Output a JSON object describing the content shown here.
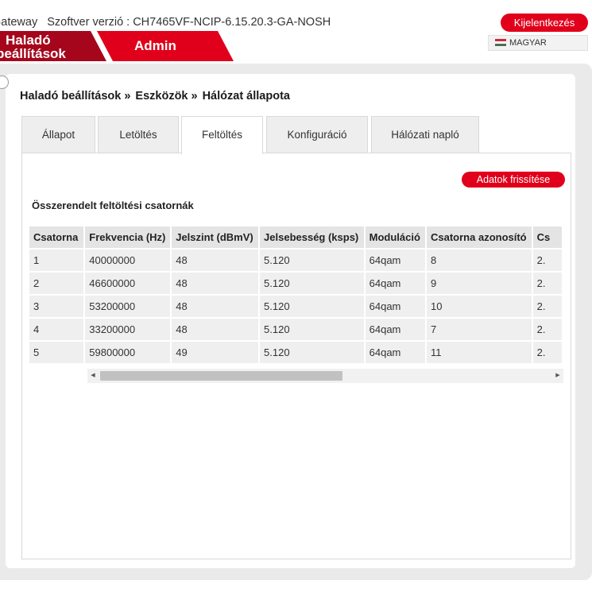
{
  "header": {
    "gateway_label": "Gateway",
    "version_label": "Szoftver verzió : CH7465VF-NCIP-6.15.20.3-GA-NOSH",
    "logout_label": "Kijelentkezés",
    "language_label": "MAGYAR",
    "tab_advanced_line1": "Haladó",
    "tab_advanced_line2": "beállítások",
    "tab_admin_label": "Admin"
  },
  "breadcrumb": {
    "item1": "Haladó beállítások",
    "item2": "Eszközök",
    "item3": "Hálózat állapota",
    "separator": "»"
  },
  "tabs": [
    {
      "label": "Állapot"
    },
    {
      "label": "Letöltés"
    },
    {
      "label": "Feltöltés"
    },
    {
      "label": "Konfiguráció"
    },
    {
      "label": "Hálózati napló"
    }
  ],
  "main": {
    "refresh_label": "Adatok frissítése",
    "section_title": "Összerendelt feltöltési csatornák"
  },
  "table": {
    "headers": [
      "Csatorna",
      "Frekvencia (Hz)",
      "Jelszint (dBmV)",
      "Jelsebesség (ksps)",
      "Moduláció",
      "Csatorna azonosító",
      "Cs"
    ],
    "rows": [
      [
        "1",
        "40000000",
        "48",
        "5.120",
        "64qam",
        "8",
        "2."
      ],
      [
        "2",
        "46600000",
        "48",
        "5.120",
        "64qam",
        "9",
        "2."
      ],
      [
        "3",
        "53200000",
        "48",
        "5.120",
        "64qam",
        "10",
        "2."
      ],
      [
        "4",
        "33200000",
        "48",
        "5.120",
        "64qam",
        "7",
        "2."
      ],
      [
        "5",
        "59800000",
        "49",
        "5.120",
        "64qam",
        "11",
        "2."
      ]
    ]
  },
  "scrollbar": {
    "left_arrow": "◀",
    "right_arrow": "▶"
  },
  "colors": {
    "brand_red": "#e0001b",
    "dark_red": "#a5061c",
    "panel_grey": "#eaeaea"
  }
}
